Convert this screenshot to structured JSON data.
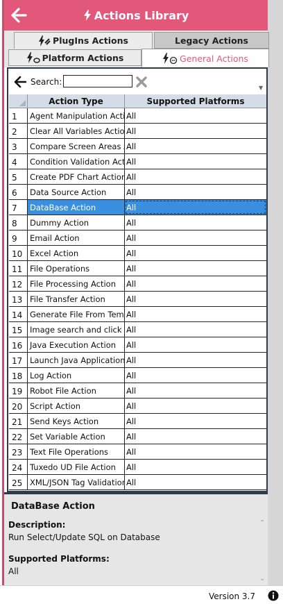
{
  "header": {
    "title": "Actions Library"
  },
  "tabs": {
    "plugins": "PlugIns Actions",
    "legacy": "Legacy Actions",
    "platform": "Platform Actions",
    "general": "General Actions"
  },
  "search": {
    "label": "Search:",
    "value": ""
  },
  "table": {
    "columns": [
      "Action Type",
      "Supported Platforms"
    ],
    "rows": [
      {
        "num": "1",
        "type": "Agent Manipulation Action",
        "platforms": "All"
      },
      {
        "num": "2",
        "type": "Clear All Variables Action",
        "platforms": "All"
      },
      {
        "num": "3",
        "type": "Compare Screen Areas Action",
        "platforms": "All"
      },
      {
        "num": "4",
        "type": "Condition Validation Action",
        "platforms": "All"
      },
      {
        "num": "5",
        "type": "Create PDF Chart Action",
        "platforms": "All"
      },
      {
        "num": "6",
        "type": "Data Source Action",
        "platforms": "All"
      },
      {
        "num": "7",
        "type": "DataBase Action",
        "platforms": "All"
      },
      {
        "num": "8",
        "type": "Dummy Action",
        "platforms": "All"
      },
      {
        "num": "9",
        "type": "Email Action",
        "platforms": "All"
      },
      {
        "num": "10",
        "type": "Excel Action",
        "platforms": "All"
      },
      {
        "num": "11",
        "type": "File Operations",
        "platforms": "All"
      },
      {
        "num": "12",
        "type": "File Processing Action",
        "platforms": "All"
      },
      {
        "num": "13",
        "type": "File Transfer Action",
        "platforms": "All"
      },
      {
        "num": "14",
        "type": "Generate File From Template",
        "platforms": "All"
      },
      {
        "num": "15",
        "type": "Image search and click on",
        "platforms": "All"
      },
      {
        "num": "16",
        "type": "Java Execution Action",
        "platforms": "All"
      },
      {
        "num": "17",
        "type": "Launch Java Application",
        "platforms": "All"
      },
      {
        "num": "18",
        "type": "Log Action",
        "platforms": "All"
      },
      {
        "num": "19",
        "type": "Robot File Action",
        "platforms": "All"
      },
      {
        "num": "20",
        "type": "Script Action",
        "platforms": "All"
      },
      {
        "num": "21",
        "type": "Send Keys Action",
        "platforms": "All"
      },
      {
        "num": "22",
        "type": "Set Variable Action",
        "platforms": "All"
      },
      {
        "num": "23",
        "type": "Text File Operations",
        "platforms": "All"
      },
      {
        "num": "24",
        "type": "Tuxedo UD File Action",
        "platforms": "All"
      },
      {
        "num": "25",
        "type": "XML/JSON Tag Validation",
        "platforms": "All"
      }
    ],
    "selected_row": 7
  },
  "details": {
    "title": "DataBase Action",
    "description_label": "Description:",
    "description": "Run Select/Update SQL on Database",
    "platforms_label": "Supported Platforms:",
    "platforms": "All"
  },
  "footer": {
    "version": "Version 3.7"
  },
  "colors": {
    "accent": "#e2587a",
    "selected": "#3b8fe0",
    "header_row": "#d6dce6"
  }
}
